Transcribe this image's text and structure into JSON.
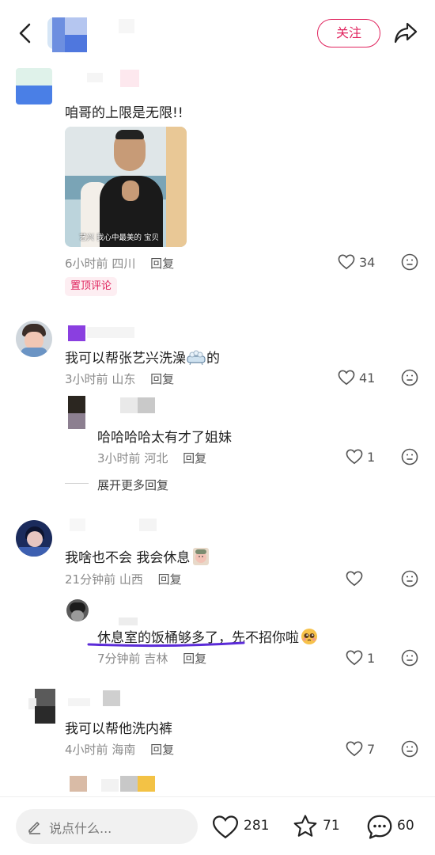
{
  "header": {
    "follow_label": "关注"
  },
  "comments": [
    {
      "text": "咱哥的上限是无限!!",
      "time": "6小时前",
      "location": "四川",
      "reply": "回复",
      "likes": "34",
      "badge": "置顶评论",
      "image_caption": "艺兴 我心中最美的 宝贝"
    },
    {
      "text": "我可以帮张艺兴洗澡",
      "suffix": "的",
      "time": "3小时前",
      "location": "山东",
      "reply": "回复",
      "likes": "41",
      "replies": [
        {
          "text": "哈哈哈哈太有才了姐妹",
          "time": "3小时前",
          "location": "河北",
          "reply": "回复",
          "likes": "1"
        }
      ],
      "expand_label": "展开更多回复"
    },
    {
      "text": "我啥也不会 我会休息",
      "time": "21分钟前",
      "location": "山西",
      "reply": "回复",
      "likes": "",
      "replies": [
        {
          "text": "休息室的饭桶够多了，先不招你啦",
          "time": "7分钟前",
          "location": "吉林",
          "reply": "回复",
          "likes": "1"
        }
      ]
    },
    {
      "text": "我可以帮他洗内裤",
      "time": "4小时前",
      "location": "海南",
      "reply": "回复",
      "likes": "7"
    }
  ],
  "bottom": {
    "placeholder": "说点什么...",
    "likes": "281",
    "favorites": "71",
    "comments": "60"
  },
  "colors": {
    "accent": "#e0245e",
    "annotation": "#5b2bd8"
  }
}
